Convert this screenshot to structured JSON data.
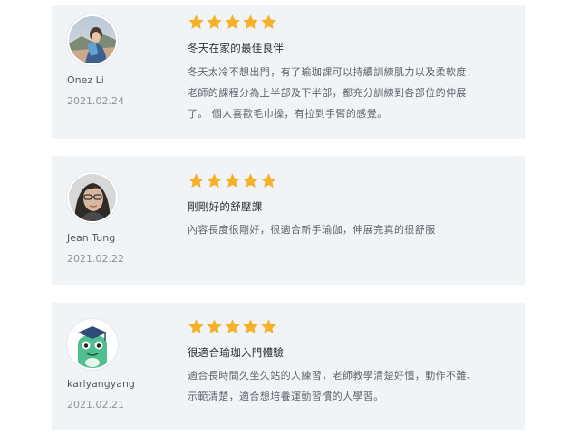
{
  "reviews": [
    {
      "avatar": "avatar-photo-woman-outdoors",
      "user": "Onez Li",
      "date": "2021.02.24",
      "rating": 5,
      "title": "冬天在家的最佳良伴",
      "body_lines": [
        "冬天太冷不想出門，有了瑜珈課可以持續訓練肌力以及柔軟度！",
        "老師的課程分為上半部及下半部，都充分訓練到各部位的伸展",
        "了。 個人喜歡毛巾操，有拉到手臂的感覺。"
      ]
    },
    {
      "avatar": "avatar-photo-woman-glasses",
      "user": "Jean Tung",
      "date": "2021.02.22",
      "rating": 5,
      "title": "剛剛好的舒壓課",
      "body_lines": [
        "內容長度很剛好，很適合新手瑜伽，伸展完真的很舒服"
      ]
    },
    {
      "avatar": "avatar-cartoon-green-graduate",
      "user": "karlyangyang",
      "date": "2021.02.21",
      "rating": 5,
      "title": "很適合瑜珈入門體驗",
      "body_lines": [
        "適合長時間久坐久站的人練習，老師教學清楚好懂，動作不難、",
        "示範清楚，適合想培養運動習慣的人學習。"
      ]
    }
  ],
  "colors": {
    "card_bg": "#f1f4f7",
    "star": "#f7b02a",
    "title": "#2b3035",
    "body": "#5d646b",
    "meta": "#8d949a"
  },
  "icons": {
    "star": "star-icon"
  }
}
